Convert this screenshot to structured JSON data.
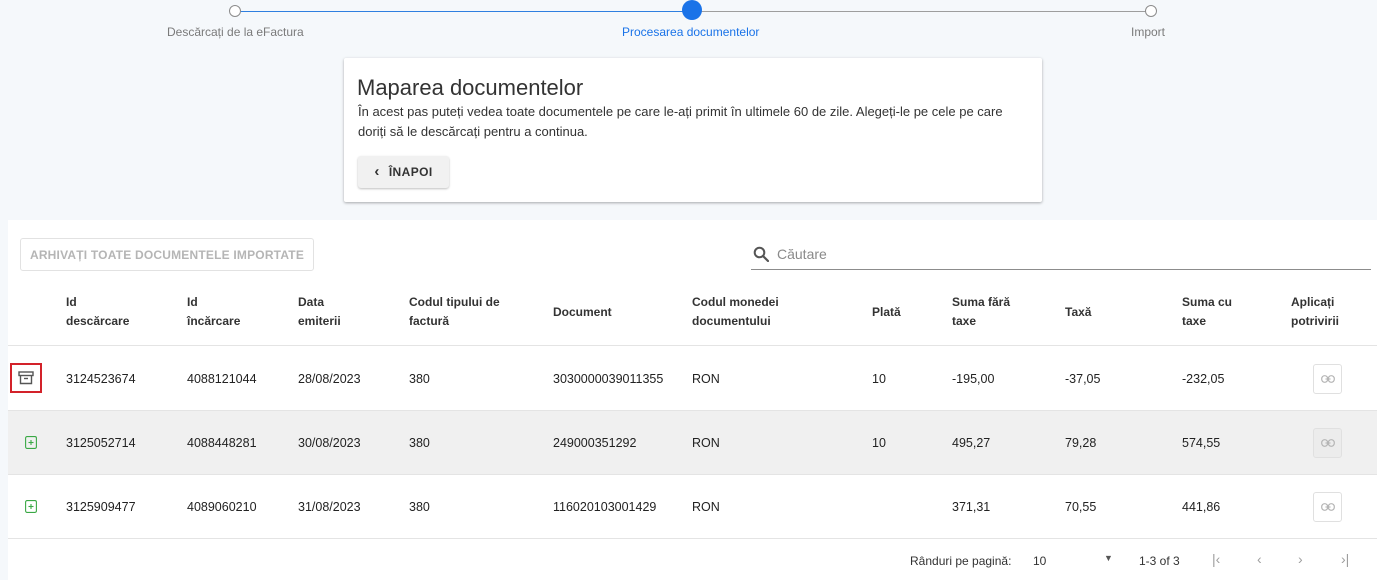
{
  "stepper": {
    "steps": [
      {
        "label": "Descărcați de la eFactura",
        "state": "done"
      },
      {
        "label": "Procesarea documentelor",
        "state": "active"
      },
      {
        "label": "Import",
        "state": "pending"
      }
    ]
  },
  "card": {
    "title": "Maparea documentelor",
    "description": "În acest pas puteți vedea toate documentele pe care le-ați primit în ultimele 60 de zile. Alegeți-le pe cele pe care doriți să le descărcați pentru a continua.",
    "back_label": "ÎNAPOI"
  },
  "toolbar": {
    "archive_all_label": "ARHIVAȚI TOATE DOCUMENTELE IMPORTATE",
    "search_placeholder": "Căutare"
  },
  "table": {
    "headers": [
      {
        "line1": "Id",
        "line2": "descărcare"
      },
      {
        "line1": "Id",
        "line2": "încărcare"
      },
      {
        "line1": "Data",
        "line2": "emiterii"
      },
      {
        "line1": "Codul tipului de",
        "line2": "factură"
      },
      {
        "line1": "Document",
        "line2": ""
      },
      {
        "line1": "Codul monedei",
        "line2": "documentului"
      },
      {
        "line1": "Plată",
        "line2": ""
      },
      {
        "line1": "Suma fără",
        "line2": "taxe"
      },
      {
        "line1": "Taxă",
        "line2": ""
      },
      {
        "line1": "Suma cu",
        "line2": "taxe"
      },
      {
        "line1": "Aplicați",
        "line2": "potrivirii"
      }
    ],
    "rows": [
      {
        "action_icon": "archive-icon",
        "download_id": "3124523674",
        "upload_id": "4088121044",
        "issue_date": "28/08/2023",
        "invoice_type": "380",
        "document": "3030000039011355",
        "currency": "RON",
        "payment": "10",
        "amount_no_tax": "-195,00",
        "tax": "-37,05",
        "amount_with_tax": "-232,05"
      },
      {
        "action_icon": "import-icon",
        "download_id": "3125052714",
        "upload_id": "4088448281",
        "issue_date": "30/08/2023",
        "invoice_type": "380",
        "document": "249000351292",
        "currency": "RON",
        "payment": "10",
        "amount_no_tax": "495,27",
        "tax": "79,28",
        "amount_with_tax": "574,55"
      },
      {
        "action_icon": "import-icon",
        "download_id": "3125909477",
        "upload_id": "4089060210",
        "issue_date": "31/08/2023",
        "invoice_type": "380",
        "document": "116020103001429",
        "currency": "RON",
        "payment": "",
        "amount_no_tax": "371,31",
        "tax": "70,55",
        "amount_with_tax": "441,86"
      }
    ]
  },
  "pagination": {
    "rows_per_page_label": "Rânduri pe pagină:",
    "rows_per_page_value": "10",
    "range_label": "1-3 of 3"
  },
  "colors": {
    "accent": "#1a73e8",
    "highlight_border": "#d3222a",
    "import_icon": "#3aa845"
  }
}
